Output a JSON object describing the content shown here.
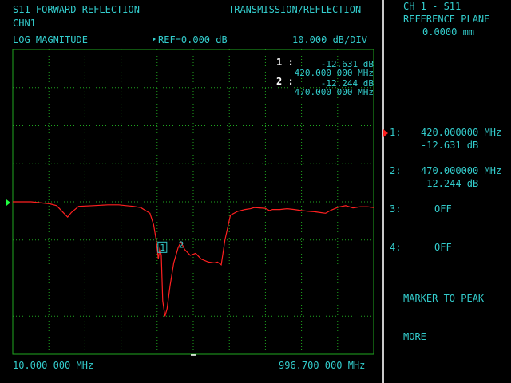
{
  "header": {
    "measurement": "S11 FORWARD REFLECTION",
    "mode": "TRANSMISSION/REFLECTION",
    "channel": "CHN1",
    "format": "LOG MAGNITUDE",
    "reference": "REF=0.000 dB",
    "scale": "10.000 dB/DIV"
  },
  "markers_readout": [
    {
      "index_label": "1 :",
      "level": "-12.631 dB",
      "freq": "420.000 000 MHz"
    },
    {
      "index_label": "2 :",
      "level": "-12.244 dB",
      "freq": "470.000 000 MHz"
    }
  ],
  "footer": {
    "start_freq": "10.000 000 MHz",
    "stop_freq": "996.700 000 MHz"
  },
  "softkeys": {
    "title_line1": "CH 1 - S11",
    "title_line2": "REFERENCE PLANE",
    "title_line3": "0.0000 mm",
    "marker1_label": "1:",
    "marker1_freq": "420.000000 MHz",
    "marker1_level": "-12.631 dB",
    "marker2_label": "2:",
    "marker2_freq": "470.000000 MHz",
    "marker2_level": "-12.244 dB",
    "marker3_label": "3:",
    "marker3_value": "OFF",
    "marker4_label": "4:",
    "marker4_value": "OFF",
    "marker_to_peak": "MARKER TO PEAK",
    "more": "MORE"
  },
  "trace_markers": {
    "m1": "1",
    "m2": "2"
  },
  "colors": {
    "text": "#33cccc",
    "grid": "#1fa81f",
    "trace": "#ff2020",
    "divider": "#c8c8c8"
  },
  "chart_data": {
    "type": "line",
    "xlabel": "",
    "ylabel": "",
    "xlim": [
      10.0,
      996.7
    ],
    "ylim": [
      -80,
      20
    ],
    "grid": true,
    "series": [
      {
        "x": [
          10,
          60,
          110,
          130,
          150,
          160,
          170,
          190,
          230,
          270,
          300,
          320,
          340,
          360,
          385,
          395,
          402,
          408,
          412,
          416,
          420,
          426,
          432,
          440,
          450,
          462,
          470,
          480,
          495,
          510,
          525,
          545,
          560,
          570,
          580,
          590,
          605,
          625,
          645,
          660,
          670,
          685,
          700,
          712,
          720,
          740,
          760,
          780,
          800,
          820,
          835,
          850,
          865,
          880,
          900,
          920,
          940,
          960,
          980,
          996.7
        ],
        "y": [
          0.0,
          0.0,
          -0.5,
          -1.0,
          -3.0,
          -4.0,
          -2.8,
          -1.2,
          -1.0,
          -0.8,
          -0.8,
          -1.0,
          -1.2,
          -1.5,
          -3.0,
          -6.0,
          -10.0,
          -15.0,
          -12.0,
          -14.0,
          -26.0,
          -30.0,
          -28.0,
          -22.0,
          -16.0,
          -12.0,
          -10.5,
          -12.5,
          -14.0,
          -13.5,
          -15.0,
          -15.8,
          -16.0,
          -15.8,
          -16.5,
          -10.0,
          -3.5,
          -2.5,
          -2.0,
          -1.8,
          -1.5,
          -1.6,
          -1.7,
          -2.3,
          -2.0,
          -2.0,
          -1.8,
          -2.0,
          -2.3,
          -2.5,
          -2.6,
          -2.8,
          -3.0,
          -2.2,
          -1.4,
          -1.0,
          -1.6,
          -1.3,
          -1.3,
          -1.5
        ]
      }
    ],
    "markers": [
      {
        "name": "1",
        "x": 420,
        "y": -12.631
      },
      {
        "name": "2",
        "x": 470,
        "y": -12.244
      }
    ]
  }
}
